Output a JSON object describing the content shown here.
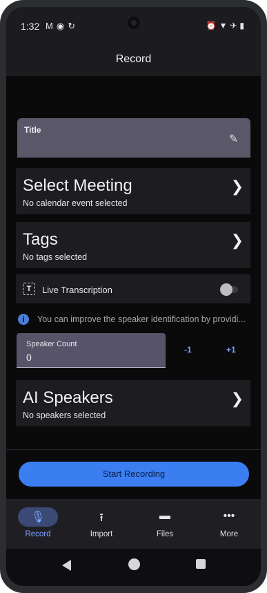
{
  "status_bar": {
    "time": "1:32",
    "left_icons": [
      "gmail-icon",
      "record-icon",
      "sync-icon"
    ],
    "right_icons": [
      "alarm-icon",
      "wifi-icon",
      "airplane-icon",
      "battery-icon"
    ]
  },
  "app_bar": {
    "title": "Record"
  },
  "title_field": {
    "label": "Title",
    "icon": "pencil-icon"
  },
  "select_meeting": {
    "title": "Select Meeting",
    "subtitle": "No calendar event selected"
  },
  "tags": {
    "title": "Tags",
    "subtitle": "No tags selected"
  },
  "live_transcription": {
    "label": "Live Transcription",
    "icon_glyph": "T",
    "enabled": false
  },
  "info": {
    "text": "You can improve the speaker identification by providi..."
  },
  "speaker_count": {
    "label": "Speaker Count",
    "value": "0",
    "decrement_label": "-1",
    "increment_label": "+1"
  },
  "ai_speakers": {
    "title": "AI Speakers",
    "subtitle": "No speakers selected"
  },
  "start_button": {
    "label": "Start Recording"
  },
  "bottom_nav": {
    "items": [
      {
        "label": "Record",
        "icon": "microphone-icon",
        "glyph": "🎙",
        "active": true
      },
      {
        "label": "Import",
        "icon": "upload-icon",
        "glyph": "⭱",
        "active": false
      },
      {
        "label": "Files",
        "icon": "folder-icon",
        "glyph": "▬",
        "active": false
      },
      {
        "label": "More",
        "icon": "more-icon",
        "glyph": "•••",
        "active": false
      }
    ]
  },
  "colors": {
    "accent": "#3b7ef2",
    "nav_active": "#7ea7ff",
    "surface": "#1d1d21",
    "background": "#0a0a0b"
  }
}
